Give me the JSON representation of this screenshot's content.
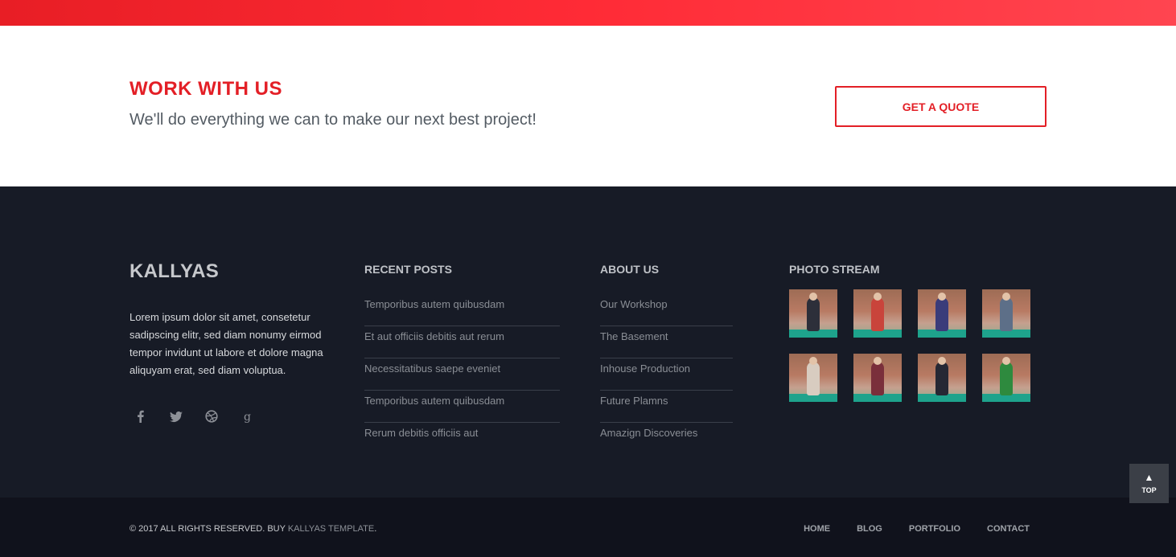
{
  "cta": {
    "title": "WORK WITH US",
    "subtitle": "We'll do everything we can to make our next best project!",
    "button": "GET A QUOTE"
  },
  "footer": {
    "logo": "KALLYAS",
    "about": "Lorem ipsum dolor sit amet, consetetur sadipscing elitr, sed diam nonumy eirmod tempor invidunt ut labore et dolore magna aliquyam erat, sed diam voluptua.",
    "social": [
      {
        "icon": "facebook-icon"
      },
      {
        "icon": "twitter-icon"
      },
      {
        "icon": "dribbble-icon"
      },
      {
        "icon": "google-plus-icon"
      }
    ],
    "recent_posts": {
      "title": "RECENT POSTS",
      "items": [
        "Temporibus autem quibusdam",
        "Et aut officiis debitis aut rerum",
        "Necessitatibus saepe eveniet",
        "Temporibus autem quibusdam",
        "Rerum debitis officiis aut"
      ]
    },
    "about_us": {
      "title": "ABOUT US",
      "items": [
        "Our Workshop",
        "The Basement",
        "Inhouse Production",
        "Future Plamns",
        "Amazign Discoveries"
      ]
    },
    "photo_stream": {
      "title": "PHOTO STREAM",
      "photos": [
        {
          "fig": "#2d2f3a"
        },
        {
          "fig": "#c9443b"
        },
        {
          "fig": "#3a3c7a"
        },
        {
          "fig": "#5d6f88"
        },
        {
          "fig": "#d8ccc0"
        },
        {
          "fig": "#7a2f3b"
        },
        {
          "fig": "#262834"
        },
        {
          "fig": "#2e8a3e"
        }
      ]
    }
  },
  "bottom": {
    "copyright": "© 2017 ALL RIGHTS RESERVED. BUY ",
    "copyright_link": "KALLYAS TEMPLATE",
    "copyright_end": ".",
    "nav": [
      "HOME",
      "BLOG",
      "PORTFOLIO",
      "CONTACT"
    ]
  },
  "to_top": {
    "label": "TOP"
  },
  "colors": {
    "accent": "#e31f26",
    "footer_bg": "#171b26",
    "bottom_bg": "#10121c"
  }
}
